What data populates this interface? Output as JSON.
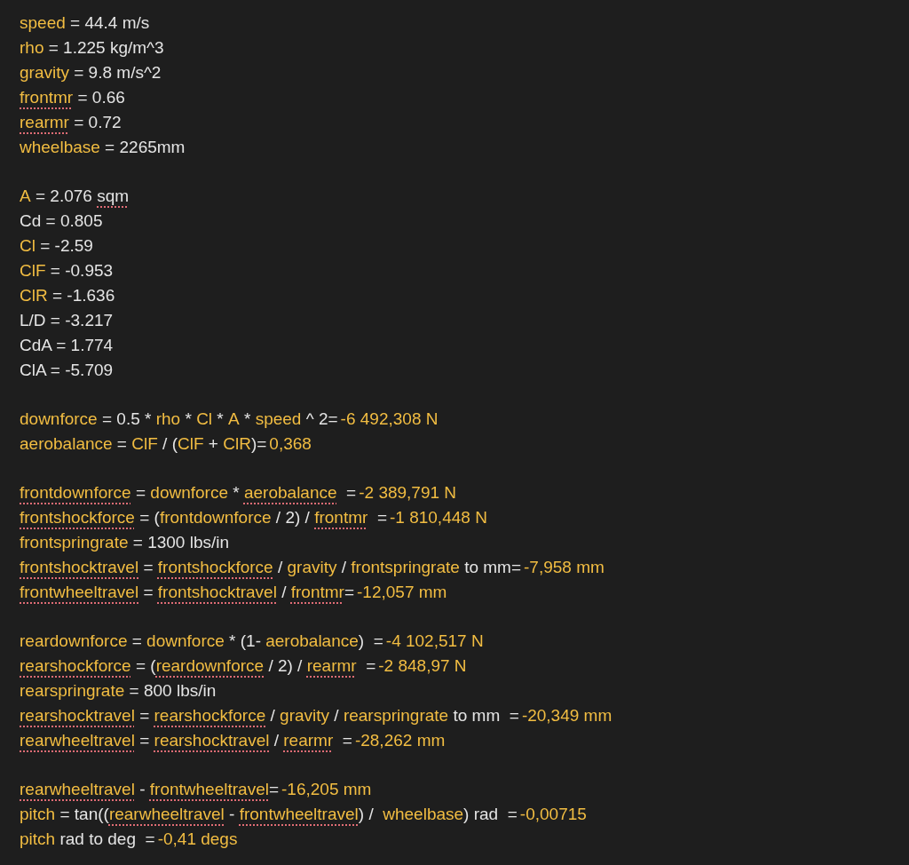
{
  "blocks": [
    [
      [
        {
          "kind": "var",
          "text": "speed",
          "misspelled": false
        },
        {
          "kind": "plain",
          "text": " = 44.4 m/s",
          "misspelled": false
        }
      ],
      [
        {
          "kind": "var",
          "text": "rho",
          "misspelled": false
        },
        {
          "kind": "plain",
          "text": " = 1.225 kg/m^3",
          "misspelled": false
        }
      ],
      [
        {
          "kind": "var",
          "text": "gravity",
          "misspelled": false
        },
        {
          "kind": "plain",
          "text": " = 9.8 m/s^2",
          "misspelled": false
        }
      ],
      [
        {
          "kind": "var",
          "text": "frontmr",
          "misspelled": true
        },
        {
          "kind": "plain",
          "text": " = 0.66",
          "misspelled": false
        }
      ],
      [
        {
          "kind": "var",
          "text": "rearmr",
          "misspelled": true
        },
        {
          "kind": "plain",
          "text": " = 0.72",
          "misspelled": false
        }
      ],
      [
        {
          "kind": "var",
          "text": "wheelbase",
          "misspelled": false
        },
        {
          "kind": "plain",
          "text": " = 2265mm",
          "misspelled": false
        }
      ]
    ],
    [
      [
        {
          "kind": "var",
          "text": "A",
          "misspelled": false
        },
        {
          "kind": "plain",
          "text": " = 2.076 ",
          "misspelled": false
        },
        {
          "kind": "plain",
          "text": "sqm",
          "misspelled": true
        }
      ],
      [
        {
          "kind": "plain",
          "text": "Cd = 0.805",
          "misspelled": false
        }
      ],
      [
        {
          "kind": "var",
          "text": "Cl",
          "misspelled": false
        },
        {
          "kind": "plain",
          "text": " = -2.59",
          "misspelled": false
        }
      ],
      [
        {
          "kind": "var",
          "text": "ClF",
          "misspelled": false
        },
        {
          "kind": "plain",
          "text": " = -0.953",
          "misspelled": false
        }
      ],
      [
        {
          "kind": "var",
          "text": "ClR",
          "misspelled": false
        },
        {
          "kind": "plain",
          "text": " = -1.636",
          "misspelled": false
        }
      ],
      [
        {
          "kind": "plain",
          "text": "L/D = -3.217",
          "misspelled": false
        }
      ],
      [
        {
          "kind": "plain",
          "text": "CdA = 1.774",
          "misspelled": false
        }
      ],
      [
        {
          "kind": "plain",
          "text": "ClA = -5.709",
          "misspelled": false
        }
      ]
    ],
    [
      [
        {
          "kind": "var",
          "text": "downforce",
          "misspelled": false
        },
        {
          "kind": "plain",
          "text": " = 0.5 * ",
          "misspelled": false
        },
        {
          "kind": "var",
          "text": "rho",
          "misspelled": false
        },
        {
          "kind": "plain",
          "text": " * ",
          "misspelled": false
        },
        {
          "kind": "var",
          "text": "Cl",
          "misspelled": false
        },
        {
          "kind": "plain",
          "text": " * ",
          "misspelled": false
        },
        {
          "kind": "var",
          "text": "A",
          "misspelled": false
        },
        {
          "kind": "plain",
          "text": " * ",
          "misspelled": false
        },
        {
          "kind": "var",
          "text": "speed",
          "misspelled": false
        },
        {
          "kind": "plain",
          "text": " ^ 2=",
          "misspelled": false
        },
        {
          "kind": "result",
          "text": "-6 492,308 N",
          "misspelled": false
        }
      ],
      [
        {
          "kind": "var",
          "text": "aerobalance",
          "misspelled": false
        },
        {
          "kind": "plain",
          "text": " = ",
          "misspelled": false
        },
        {
          "kind": "var",
          "text": "ClF",
          "misspelled": false
        },
        {
          "kind": "plain",
          "text": " / (",
          "misspelled": false
        },
        {
          "kind": "var",
          "text": "ClF",
          "misspelled": false
        },
        {
          "kind": "plain",
          "text": " + ",
          "misspelled": false
        },
        {
          "kind": "var",
          "text": "ClR",
          "misspelled": false
        },
        {
          "kind": "plain",
          "text": ")=",
          "misspelled": false
        },
        {
          "kind": "result",
          "text": "0,368",
          "misspelled": false
        }
      ]
    ],
    [
      [
        {
          "kind": "var",
          "text": "frontdownforce",
          "misspelled": true
        },
        {
          "kind": "plain",
          "text": " = ",
          "misspelled": false
        },
        {
          "kind": "var",
          "text": "downforce",
          "misspelled": false
        },
        {
          "kind": "plain",
          "text": " * ",
          "misspelled": false
        },
        {
          "kind": "var",
          "text": "aerobalance",
          "misspelled": true
        },
        {
          "kind": "plain",
          "text": "  =",
          "misspelled": false
        },
        {
          "kind": "result",
          "text": "-2 389,791 N",
          "misspelled": false
        }
      ],
      [
        {
          "kind": "var",
          "text": "frontshockforce",
          "misspelled": true
        },
        {
          "kind": "plain",
          "text": " = (",
          "misspelled": false
        },
        {
          "kind": "var",
          "text": "frontdownforce",
          "misspelled": false
        },
        {
          "kind": "plain",
          "text": " / 2) / ",
          "misspelled": false
        },
        {
          "kind": "var",
          "text": "frontmr",
          "misspelled": true
        },
        {
          "kind": "plain",
          "text": "  =",
          "misspelled": false
        },
        {
          "kind": "result",
          "text": "-1 810,448 N",
          "misspelled": false
        }
      ],
      [
        {
          "kind": "var",
          "text": "frontspringrate",
          "misspelled": false
        },
        {
          "kind": "plain",
          "text": " = 1300 lbs/in",
          "misspelled": false
        }
      ],
      [
        {
          "kind": "var",
          "text": "frontshocktravel",
          "misspelled": true
        },
        {
          "kind": "plain",
          "text": " = ",
          "misspelled": false
        },
        {
          "kind": "var",
          "text": "frontshockforce",
          "misspelled": true
        },
        {
          "kind": "plain",
          "text": " / ",
          "misspelled": false
        },
        {
          "kind": "var",
          "text": "gravity",
          "misspelled": false
        },
        {
          "kind": "plain",
          "text": " / ",
          "misspelled": false
        },
        {
          "kind": "var",
          "text": "frontspringrate",
          "misspelled": false
        },
        {
          "kind": "plain",
          "text": " to mm=",
          "misspelled": false
        },
        {
          "kind": "result",
          "text": "-7,958 mm",
          "misspelled": false
        }
      ],
      [
        {
          "kind": "var",
          "text": "frontwheeltravel",
          "misspelled": true
        },
        {
          "kind": "plain",
          "text": " = ",
          "misspelled": false
        },
        {
          "kind": "var",
          "text": "frontshocktravel",
          "misspelled": true
        },
        {
          "kind": "plain",
          "text": " / ",
          "misspelled": false
        },
        {
          "kind": "var",
          "text": "frontmr",
          "misspelled": true
        },
        {
          "kind": "plain",
          "text": "=",
          "misspelled": false
        },
        {
          "kind": "result",
          "text": "-12,057 mm",
          "misspelled": false
        }
      ]
    ],
    [
      [
        {
          "kind": "var",
          "text": "reardownforce",
          "misspelled": false
        },
        {
          "kind": "plain",
          "text": " = ",
          "misspelled": false
        },
        {
          "kind": "var",
          "text": "downforce",
          "misspelled": false
        },
        {
          "kind": "plain",
          "text": " * (1- ",
          "misspelled": false
        },
        {
          "kind": "var",
          "text": "aerobalance",
          "misspelled": false
        },
        {
          "kind": "plain",
          "text": ")  =",
          "misspelled": false
        },
        {
          "kind": "result",
          "text": "-4 102,517 N",
          "misspelled": false
        }
      ],
      [
        {
          "kind": "var",
          "text": "rearshockforce",
          "misspelled": true
        },
        {
          "kind": "plain",
          "text": " = (",
          "misspelled": false
        },
        {
          "kind": "var",
          "text": "reardownforce",
          "misspelled": true
        },
        {
          "kind": "plain",
          "text": " / 2) / ",
          "misspelled": false
        },
        {
          "kind": "var",
          "text": "rearmr",
          "misspelled": true
        },
        {
          "kind": "plain",
          "text": "  =",
          "misspelled": false
        },
        {
          "kind": "result",
          "text": "-2 848,97 N",
          "misspelled": false
        }
      ],
      [
        {
          "kind": "var",
          "text": "rearspringrate",
          "misspelled": false
        },
        {
          "kind": "plain",
          "text": " = 800 lbs/in",
          "misspelled": false
        }
      ],
      [
        {
          "kind": "var",
          "text": "rearshocktravel",
          "misspelled": true
        },
        {
          "kind": "plain",
          "text": " = ",
          "misspelled": false
        },
        {
          "kind": "var",
          "text": "rearshockforce",
          "misspelled": true
        },
        {
          "kind": "plain",
          "text": " / ",
          "misspelled": false
        },
        {
          "kind": "var",
          "text": "gravity",
          "misspelled": false
        },
        {
          "kind": "plain",
          "text": " / ",
          "misspelled": false
        },
        {
          "kind": "var",
          "text": "rearspringrate",
          "misspelled": false
        },
        {
          "kind": "plain",
          "text": " to mm  =",
          "misspelled": false
        },
        {
          "kind": "result",
          "text": "-20,349 mm",
          "misspelled": false
        }
      ],
      [
        {
          "kind": "var",
          "text": "rearwheeltravel",
          "misspelled": true
        },
        {
          "kind": "plain",
          "text": " = ",
          "misspelled": false
        },
        {
          "kind": "var",
          "text": "rearshocktravel",
          "misspelled": true
        },
        {
          "kind": "plain",
          "text": " / ",
          "misspelled": false
        },
        {
          "kind": "var",
          "text": "rearmr",
          "misspelled": true
        },
        {
          "kind": "plain",
          "text": "  =",
          "misspelled": false
        },
        {
          "kind": "result",
          "text": "-28,262 mm",
          "misspelled": false
        }
      ]
    ],
    [
      [
        {
          "kind": "var",
          "text": "rearwheeltravel",
          "misspelled": true
        },
        {
          "kind": "plain",
          "text": " - ",
          "misspelled": false
        },
        {
          "kind": "var",
          "text": "frontwheeltravel",
          "misspelled": true
        },
        {
          "kind": "plain",
          "text": "=",
          "misspelled": false
        },
        {
          "kind": "result",
          "text": "-16,205 mm",
          "misspelled": false
        }
      ],
      [
        {
          "kind": "var",
          "text": "pitch",
          "misspelled": false
        },
        {
          "kind": "plain",
          "text": " = tan((",
          "misspelled": false
        },
        {
          "kind": "var",
          "text": "rearwheeltravel",
          "misspelled": true
        },
        {
          "kind": "plain",
          "text": " - ",
          "misspelled": false
        },
        {
          "kind": "var",
          "text": "frontwheeltravel",
          "misspelled": true
        },
        {
          "kind": "plain",
          "text": ") /  ",
          "misspelled": false
        },
        {
          "kind": "var",
          "text": "wheelbase",
          "misspelled": false
        },
        {
          "kind": "plain",
          "text": ") rad  =",
          "misspelled": false
        },
        {
          "kind": "result",
          "text": "-0,00715",
          "misspelled": false
        }
      ],
      [
        {
          "kind": "var",
          "text": "pitch",
          "misspelled": false
        },
        {
          "kind": "plain",
          "text": " rad to deg  =",
          "misspelled": false
        },
        {
          "kind": "result",
          "text": "-0,41 degs",
          "misspelled": false
        }
      ]
    ]
  ]
}
